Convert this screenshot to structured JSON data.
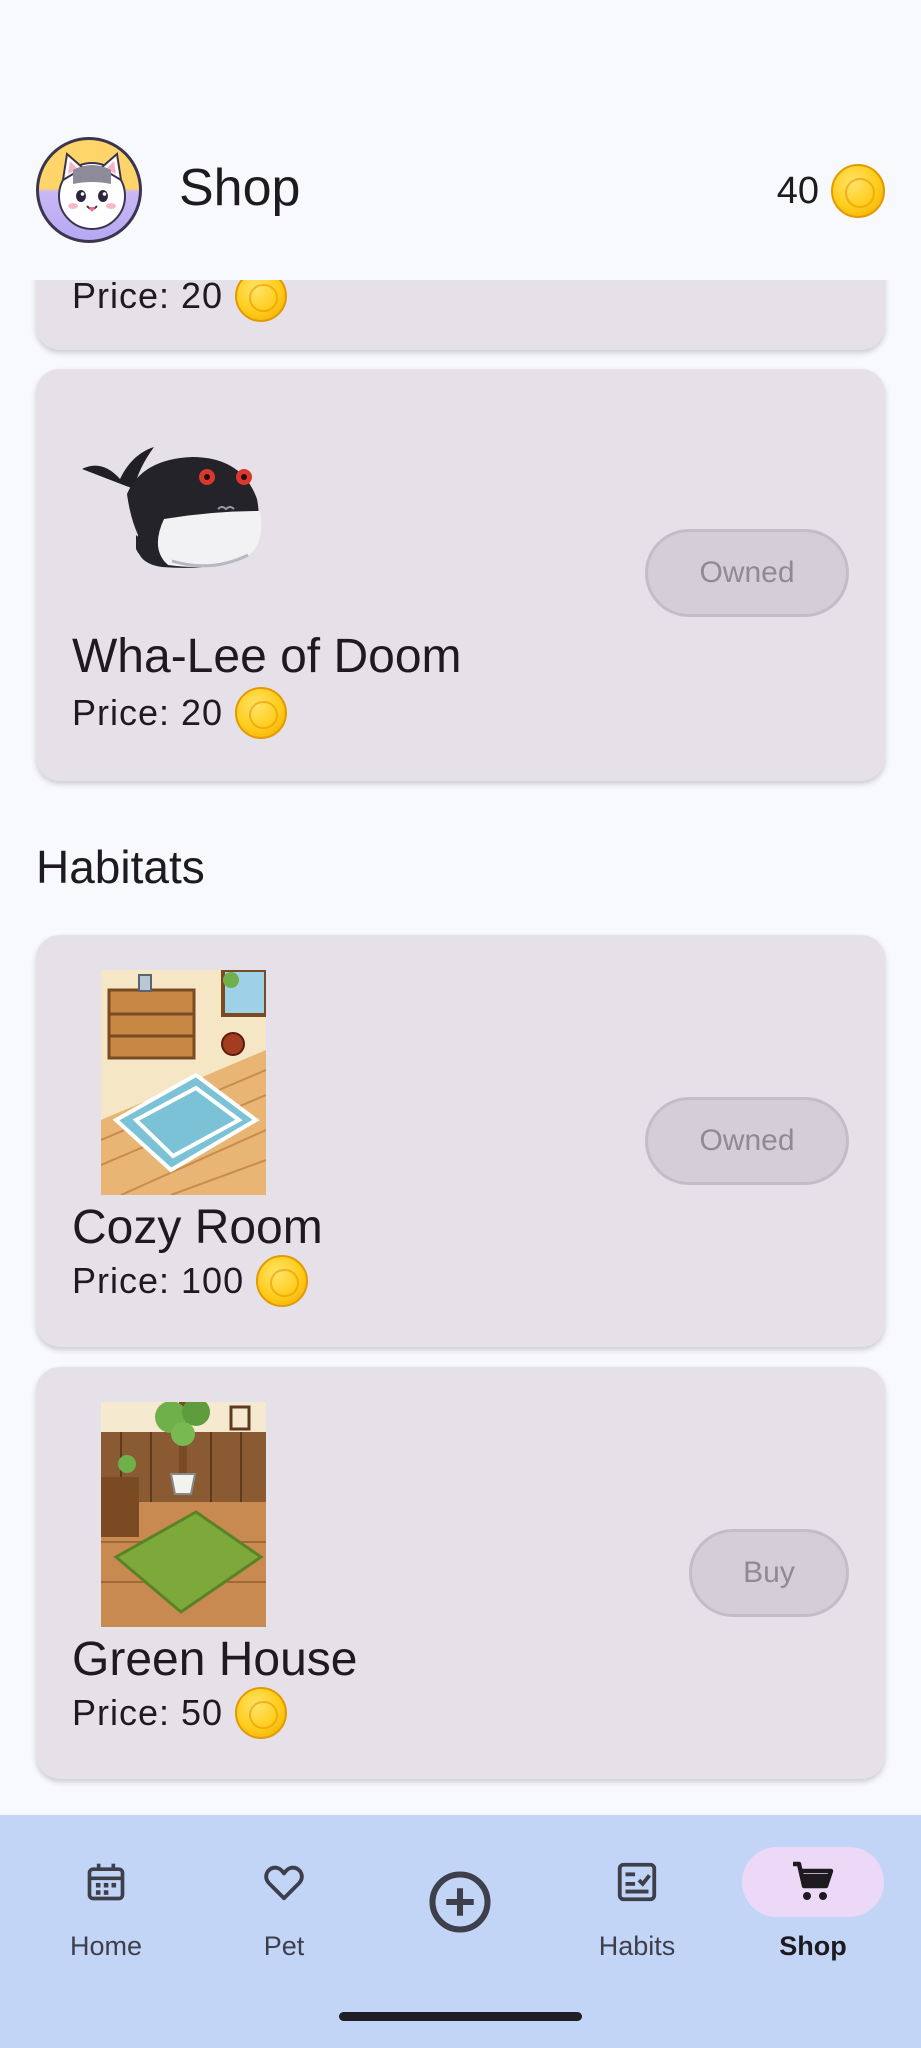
{
  "status_bar": {
    "time": "",
    "indicators": ""
  },
  "header": {
    "title": "Shop",
    "coin_balance": "40"
  },
  "items": [
    {
      "name": "",
      "price_label": "Price: 20"
    },
    {
      "name": "Wha-Lee of Doom",
      "price_label": "Price: 20",
      "action": "Owned"
    }
  ],
  "habitats_section": {
    "title": "Habitats",
    "items": [
      {
        "name": "Cozy Room",
        "price_label": "Price: 100",
        "action": "Owned"
      },
      {
        "name": "Green House",
        "price_label": "Price: 50",
        "action": "Buy"
      }
    ]
  },
  "bottom_nav": {
    "items": [
      {
        "label": "Home",
        "icon": "calendar-icon"
      },
      {
        "label": "Pet",
        "icon": "heart-icon"
      },
      {
        "label": "",
        "icon": "add-circle-icon"
      },
      {
        "label": "Habits",
        "icon": "checklist-icon"
      },
      {
        "label": "Shop",
        "icon": "cart-icon",
        "active": true
      }
    ]
  },
  "colors": {
    "background": "#f7f9fc",
    "card": "#e6e0e9",
    "nav_bar": "#c3d5f7",
    "active_pill": "#ecd9f7",
    "coin": "#ffcc1a"
  }
}
